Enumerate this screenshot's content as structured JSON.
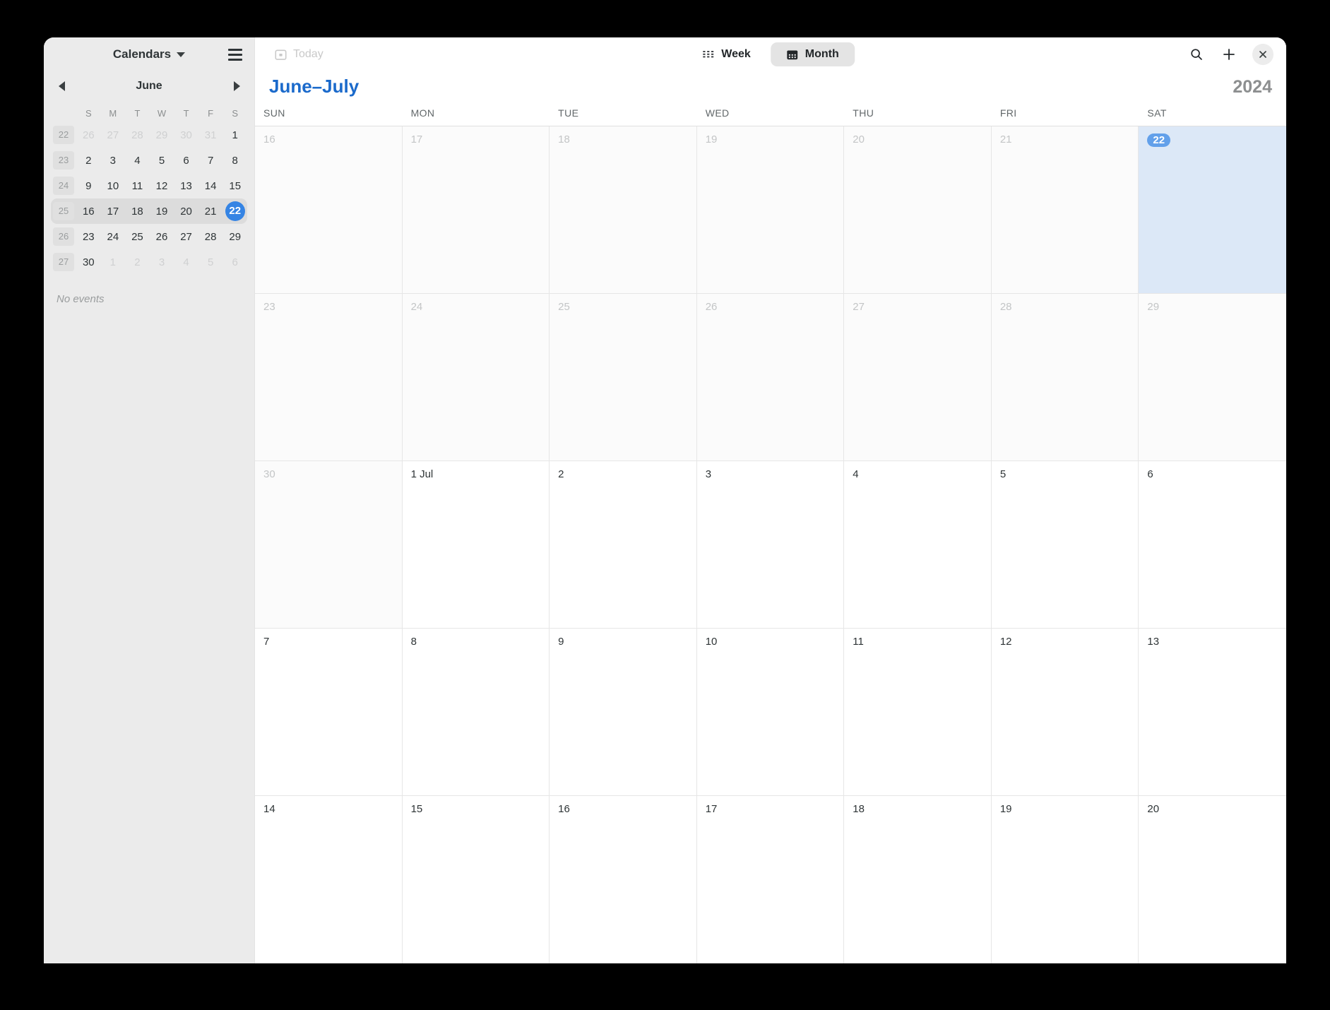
{
  "sidebar": {
    "calendars_label": "Calendars",
    "menu_icon": "hamburger-icon",
    "nav": {
      "prev_icon": "chevron-left-icon",
      "next_icon": "chevron-right-icon",
      "month_label": "June"
    },
    "dow_initials": [
      "S",
      "M",
      "T",
      "W",
      "T",
      "F",
      "S"
    ],
    "week_numbers": [
      "22",
      "23",
      "24",
      "25",
      "26",
      "27"
    ],
    "mini_weeks": [
      {
        "week": "22",
        "current": false,
        "days": [
          {
            "n": "26",
            "dim": true
          },
          {
            "n": "27",
            "dim": true
          },
          {
            "n": "28",
            "dim": true
          },
          {
            "n": "29",
            "dim": true
          },
          {
            "n": "30",
            "dim": true
          },
          {
            "n": "31",
            "dim": true
          },
          {
            "n": "1",
            "dim": false
          }
        ]
      },
      {
        "week": "23",
        "current": false,
        "days": [
          {
            "n": "2",
            "dim": false
          },
          {
            "n": "3",
            "dim": false
          },
          {
            "n": "4",
            "dim": false
          },
          {
            "n": "5",
            "dim": false
          },
          {
            "n": "6",
            "dim": false
          },
          {
            "n": "7",
            "dim": false
          },
          {
            "n": "8",
            "dim": false
          }
        ]
      },
      {
        "week": "24",
        "current": false,
        "days": [
          {
            "n": "9",
            "dim": false
          },
          {
            "n": "10",
            "dim": false
          },
          {
            "n": "11",
            "dim": false
          },
          {
            "n": "12",
            "dim": false
          },
          {
            "n": "13",
            "dim": false
          },
          {
            "n": "14",
            "dim": false
          },
          {
            "n": "15",
            "dim": false
          }
        ]
      },
      {
        "week": "25",
        "current": true,
        "days": [
          {
            "n": "16",
            "dim": false
          },
          {
            "n": "17",
            "dim": false
          },
          {
            "n": "18",
            "dim": false
          },
          {
            "n": "19",
            "dim": false
          },
          {
            "n": "20",
            "dim": false
          },
          {
            "n": "21",
            "dim": false
          },
          {
            "n": "22",
            "dim": false,
            "selected": true
          }
        ]
      },
      {
        "week": "26",
        "current": false,
        "days": [
          {
            "n": "23",
            "dim": false
          },
          {
            "n": "24",
            "dim": false
          },
          {
            "n": "25",
            "dim": false
          },
          {
            "n": "26",
            "dim": false
          },
          {
            "n": "27",
            "dim": false
          },
          {
            "n": "28",
            "dim": false
          },
          {
            "n": "29",
            "dim": false
          }
        ]
      },
      {
        "week": "27",
        "current": false,
        "days": [
          {
            "n": "30",
            "dim": false
          },
          {
            "n": "1",
            "dim": true
          },
          {
            "n": "2",
            "dim": true
          },
          {
            "n": "3",
            "dim": true
          },
          {
            "n": "4",
            "dim": true
          },
          {
            "n": "5",
            "dim": true
          },
          {
            "n": "6",
            "dim": true
          }
        ]
      }
    ],
    "events": {
      "empty_text": "No events"
    }
  },
  "toolbar": {
    "today_label": "Today",
    "today_icon": "calendar-today-icon",
    "today_enabled": false,
    "week_label": "Week",
    "week_icon": "week-grid-icon",
    "month_label": "Month",
    "month_icon": "month-calendar-icon",
    "active_view": "Month",
    "search_icon": "search-icon",
    "add_icon": "plus-icon",
    "close_icon": "close-icon"
  },
  "main": {
    "range_title": "June–July",
    "year": "2024",
    "accent_color": "#1b6acb",
    "selected_bg": "#dce8f7",
    "dow_headers": [
      "SUN",
      "MON",
      "TUE",
      "WED",
      "THU",
      "FRI",
      "SAT"
    ],
    "weeks": [
      {
        "days": [
          {
            "label": "16",
            "in_month": false
          },
          {
            "label": "17",
            "in_month": false
          },
          {
            "label": "18",
            "in_month": false
          },
          {
            "label": "19",
            "in_month": false
          },
          {
            "label": "20",
            "in_month": false
          },
          {
            "label": "21",
            "in_month": false
          },
          {
            "label": "22",
            "in_month": false,
            "selected": true
          }
        ]
      },
      {
        "days": [
          {
            "label": "23",
            "in_month": false
          },
          {
            "label": "24",
            "in_month": false
          },
          {
            "label": "25",
            "in_month": false
          },
          {
            "label": "26",
            "in_month": false
          },
          {
            "label": "27",
            "in_month": false
          },
          {
            "label": "28",
            "in_month": false
          },
          {
            "label": "29",
            "in_month": false
          }
        ]
      },
      {
        "days": [
          {
            "label": "30",
            "in_month": false
          },
          {
            "label": "1 Jul",
            "in_month": true
          },
          {
            "label": "2",
            "in_month": true
          },
          {
            "label": "3",
            "in_month": true
          },
          {
            "label": "4",
            "in_month": true
          },
          {
            "label": "5",
            "in_month": true
          },
          {
            "label": "6",
            "in_month": true
          }
        ]
      },
      {
        "days": [
          {
            "label": "7",
            "in_month": true
          },
          {
            "label": "8",
            "in_month": true
          },
          {
            "label": "9",
            "in_month": true
          },
          {
            "label": "10",
            "in_month": true
          },
          {
            "label": "11",
            "in_month": true
          },
          {
            "label": "12",
            "in_month": true
          },
          {
            "label": "13",
            "in_month": true
          }
        ]
      },
      {
        "days": [
          {
            "label": "14",
            "in_month": true
          },
          {
            "label": "15",
            "in_month": true
          },
          {
            "label": "16",
            "in_month": true
          },
          {
            "label": "17",
            "in_month": true
          },
          {
            "label": "18",
            "in_month": true
          },
          {
            "label": "19",
            "in_month": true
          },
          {
            "label": "20",
            "in_month": true
          }
        ]
      }
    ]
  }
}
